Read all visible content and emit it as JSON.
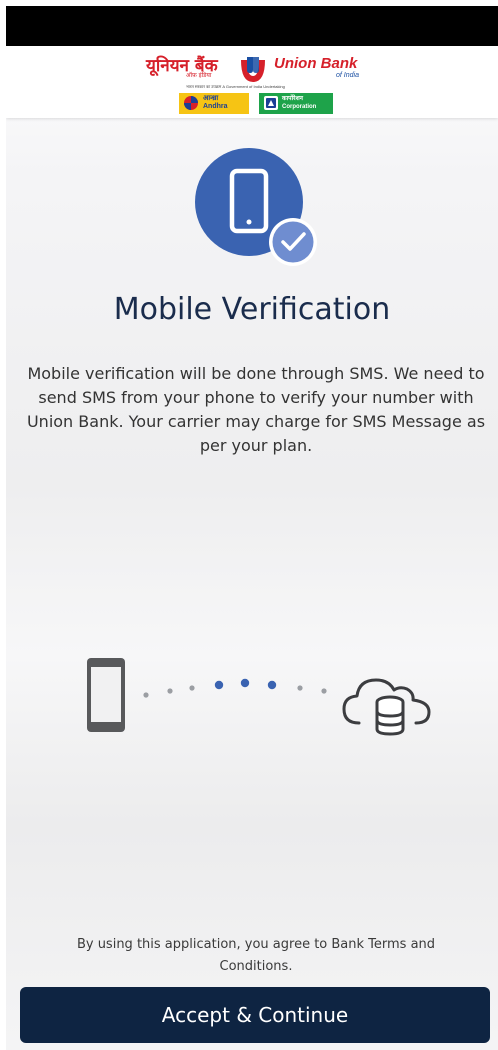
{
  "header": {
    "brand_hindi": "यूनियन बैंक",
    "brand_hindi_sub": "ऑफ़ इंडिया",
    "brand_english": "Union Bank",
    "brand_english_sub": "of India",
    "tagline": "भारत सरकार का उपक्रम  A Government of India Undertaking",
    "partner_andhra_hindi": "आन्ध्रा",
    "partner_andhra_english": "Andhra",
    "partner_corp_hindi": "कार्पोरेशन",
    "partner_corp_english": "Corporation"
  },
  "main": {
    "title": "Mobile Verification",
    "description": "Mobile verification will be done through SMS. We need to send SMS from your phone to verify your number with Union Bank. Your carrier may charge for SMS Message as per your plan."
  },
  "footer": {
    "terms": "By using this application, you agree to Bank Terms and Conditions.",
    "accept_label": "Accept & Continue"
  },
  "icons": {
    "hero": "mobile-verified-icon",
    "phone": "smartphone-icon",
    "cloud": "cloud-database-icon"
  },
  "colors": {
    "brand_red": "#d6202a",
    "brand_blue": "#1a4fa3",
    "hero_blue": "#3a63b1",
    "title": "#1a2c4c",
    "button": "#0e2442"
  }
}
